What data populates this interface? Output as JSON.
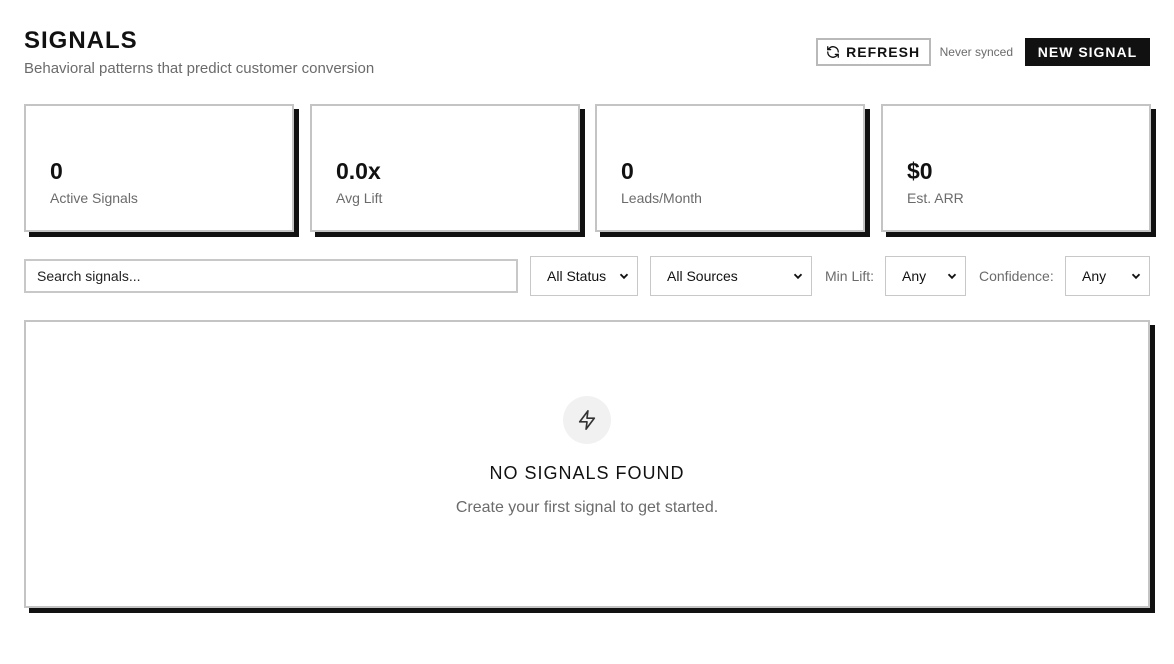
{
  "header": {
    "title": "SIGNALS",
    "subtitle": "Behavioral patterns that predict customer conversion",
    "refresh_label": "REFRESH",
    "sync_status": "Never synced",
    "new_signal_label": "NEW SIGNAL"
  },
  "stats": [
    {
      "value": "0",
      "label": "Active Signals"
    },
    {
      "value": "0.0x",
      "label": "Avg Lift"
    },
    {
      "value": "0",
      "label": "Leads/Month"
    },
    {
      "value": "$0",
      "label": "Est. ARR"
    }
  ],
  "filters": {
    "search_placeholder": "Search signals...",
    "status_selected": "All Status",
    "source_selected": "All Sources",
    "min_lift_label": "Min Lift:",
    "min_lift_selected": "Any",
    "confidence_label": "Confidence:",
    "confidence_selected": "Any"
  },
  "empty_state": {
    "icon": "lightning-icon",
    "title": "NO SIGNALS FOUND",
    "message": "Create your first signal to get started."
  },
  "colors": {
    "primary": "#111111",
    "muted_text": "#6b6b6b",
    "border": "#c4c4c4",
    "background": "#ffffff"
  }
}
